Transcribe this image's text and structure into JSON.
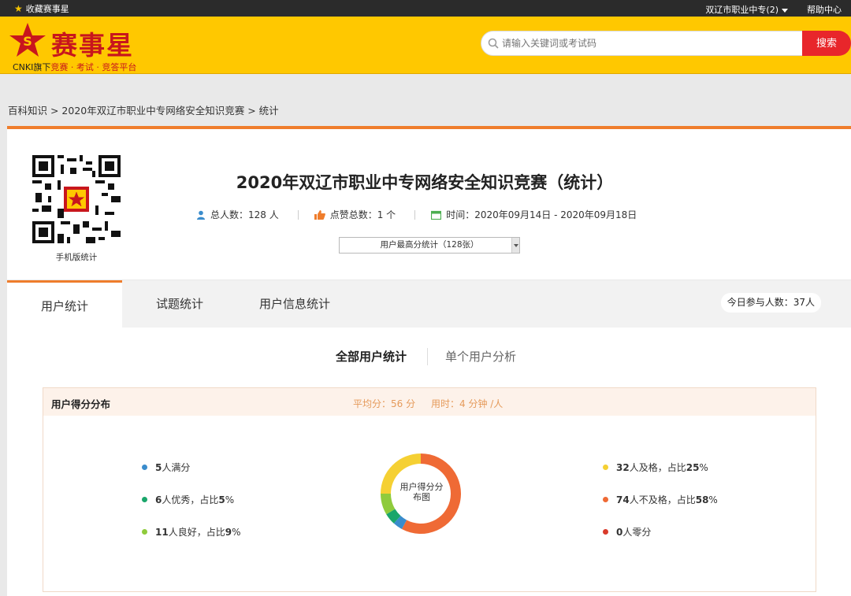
{
  "topbar": {
    "favorite_label": "收藏赛事星",
    "user_label": "双辽市职业中专(2)",
    "help_label": "帮助中心"
  },
  "header": {
    "brand_name": "赛事星",
    "tagline_prefix": "CNKI旗下",
    "tagline_highlight": "竞赛 · 考试 · 竞答平台",
    "search_placeholder": "请输入关键词或考试码",
    "search_button": "搜索",
    "accent_color": "#ffc800"
  },
  "breadcrumb": "百科知识 > 2020年双辽市职业中专网络安全知识竞赛 > 统计",
  "card": {
    "qr_caption": "手机版统计",
    "title": "2020年双辽市职业中专网络安全知识竞赛（统计）",
    "total_people": "总人数：128 人",
    "likes": "点赞总数：1 个",
    "time": "时间：2020年09月14日 - 2020年09月18日",
    "select_value": "用户最高分统计（128张）"
  },
  "tabs": {
    "items": [
      "用户统计",
      "试题统计",
      "用户信息统计"
    ],
    "today_count": "今日参与人数：37人"
  },
  "subtabs": {
    "all": "全部用户统计",
    "single": "单个用户分析"
  },
  "panel": {
    "title": "用户得分分布",
    "avg": "平均分：56 分",
    "time": "用时：4 分钟 /人"
  },
  "chart_data": {
    "type": "pie",
    "title": "用户得分分布图",
    "center_label": "用户得分分布图",
    "slices": [
      {
        "label": "满分",
        "count": 5,
        "percent": null,
        "color": "#3a8ccc"
      },
      {
        "label": "优秀",
        "count": 6,
        "percent": 5,
        "color": "#1aa66b"
      },
      {
        "label": "良好",
        "count": 11,
        "percent": 9,
        "color": "#8fcb3c"
      },
      {
        "label": "及格",
        "count": 32,
        "percent": 25,
        "color": "#f5d033"
      },
      {
        "label": "不及格",
        "count": 74,
        "percent": 58,
        "color": "#ef6a35"
      },
      {
        "label": "零分",
        "count": 0,
        "percent": null,
        "color": "#d93a2b"
      }
    ]
  },
  "legend": {
    "l1_num": "5",
    "l1_text": "人满分",
    "l2_num": "6",
    "l2_text": "人优秀，占比",
    "l2_pct": "5",
    "l2_pct_suffix": "%",
    "l3_num": "11",
    "l3_text": "人良好，占比",
    "l3_pct": "9",
    "l3_pct_suffix": "%",
    "r1_num": "32",
    "r1_text": "人及格，占比",
    "r1_pct": "25",
    "r1_pct_suffix": "%",
    "r2_num": "74",
    "r2_text": "人不及格，占比",
    "r2_pct": "58",
    "r2_pct_suffix": "%",
    "r3_num": "0",
    "r3_text": "人零分"
  }
}
